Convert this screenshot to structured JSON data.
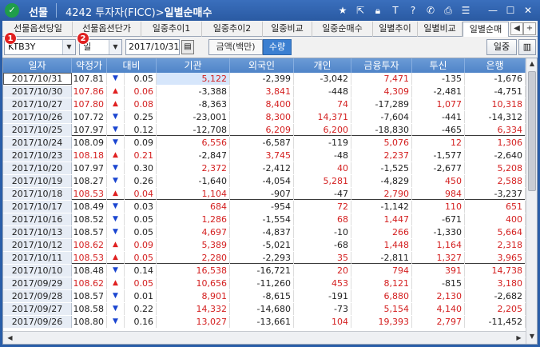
{
  "window": {
    "app_name": "선물",
    "screen_code": "4242",
    "screen_name": "투자자(FICC)",
    "sub_title": "일별순매수"
  },
  "titlebar_icons": [
    "star-icon",
    "export-icon",
    "lock-icon",
    "font-icon",
    "help-icon",
    "phone-icon",
    "print-icon",
    "menu-icon",
    "minimize-icon",
    "maximize-icon",
    "close-icon"
  ],
  "tabs": [
    {
      "label": "선물옵션당일"
    },
    {
      "label": "선물옵션단가"
    },
    {
      "label": "일중추이1"
    },
    {
      "label": "일중추이2"
    },
    {
      "label": "일중비교"
    },
    {
      "label": "일중순매수"
    },
    {
      "label": "일별추이"
    },
    {
      "label": "일별비교"
    },
    {
      "label": "일별순매"
    }
  ],
  "active_tab": 8,
  "toolbar": {
    "instrument": "KTB3Y",
    "period": "일",
    "date": "2017/10/31",
    "badge1": "1",
    "badge2": "2",
    "toggle_amount": "금액(백만)",
    "toggle_qty": "수량",
    "btn_intraday": "일중",
    "chart_icon": "bar-chart-icon"
  },
  "columns": [
    "일자",
    "약정가",
    "대비",
    "기관",
    "외국인",
    "개인",
    "금융투자",
    "투신",
    "은행"
  ],
  "rows": [
    {
      "date": "2017/10/31",
      "price": "107.81",
      "dir": "down",
      "chg": "0.05",
      "inst": "5,122",
      "foreign": "-2,399",
      "indiv": "-3,042",
      "fin": "7,471",
      "trust": "-135",
      "bank": "-1,676"
    },
    {
      "date": "2017/10/30",
      "price": "107.86",
      "dir": "up",
      "chg": "0.06",
      "inst": "-3,388",
      "foreign": "3,841",
      "indiv": "-448",
      "fin": "4,309",
      "trust": "-2,481",
      "bank": "-4,751"
    },
    {
      "date": "2017/10/27",
      "price": "107.80",
      "dir": "up",
      "chg": "0.08",
      "inst": "-8,363",
      "foreign": "8,400",
      "indiv": "74",
      "fin": "-17,289",
      "trust": "1,077",
      "bank": "10,318"
    },
    {
      "date": "2017/10/26",
      "price": "107.72",
      "dir": "down",
      "chg": "0.25",
      "inst": "-23,001",
      "foreign": "8,300",
      "indiv": "14,371",
      "fin": "-7,604",
      "trust": "-441",
      "bank": "-14,312"
    },
    {
      "date": "2017/10/25",
      "price": "107.97",
      "dir": "down",
      "chg": "0.12",
      "inst": "-12,708",
      "foreign": "6,209",
      "indiv": "6,200",
      "fin": "-18,830",
      "trust": "-465",
      "bank": "6,334"
    },
    {
      "date": "2017/10/24",
      "price": "108.09",
      "dir": "down",
      "chg": "0.09",
      "inst": "6,556",
      "foreign": "-6,587",
      "indiv": "-119",
      "fin": "5,076",
      "trust": "12",
      "bank": "1,306"
    },
    {
      "date": "2017/10/23",
      "price": "108.18",
      "dir": "up",
      "chg": "0.21",
      "inst": "-2,847",
      "foreign": "3,745",
      "indiv": "-48",
      "fin": "2,237",
      "trust": "-1,577",
      "bank": "-2,640"
    },
    {
      "date": "2017/10/20",
      "price": "107.97",
      "dir": "down",
      "chg": "0.30",
      "inst": "2,372",
      "foreign": "-2,412",
      "indiv": "40",
      "fin": "-1,525",
      "trust": "-2,677",
      "bank": "5,208"
    },
    {
      "date": "2017/10/19",
      "price": "108.27",
      "dir": "down",
      "chg": "0.26",
      "inst": "-1,640",
      "foreign": "-4,054",
      "indiv": "5,281",
      "fin": "-4,829",
      "trust": "450",
      "bank": "2,588"
    },
    {
      "date": "2017/10/18",
      "price": "108.53",
      "dir": "up",
      "chg": "0.04",
      "inst": "1,104",
      "foreign": "-907",
      "indiv": "-47",
      "fin": "2,790",
      "trust": "984",
      "bank": "-3,237"
    },
    {
      "date": "2017/10/17",
      "price": "108.49",
      "dir": "down",
      "chg": "0.03",
      "inst": "684",
      "foreign": "-954",
      "indiv": "72",
      "fin": "-1,142",
      "trust": "110",
      "bank": "651"
    },
    {
      "date": "2017/10/16",
      "price": "108.52",
      "dir": "down",
      "chg": "0.05",
      "inst": "1,286",
      "foreign": "-1,554",
      "indiv": "68",
      "fin": "1,447",
      "trust": "-671",
      "bank": "400"
    },
    {
      "date": "2017/10/13",
      "price": "108.57",
      "dir": "down",
      "chg": "0.05",
      "inst": "4,697",
      "foreign": "-4,837",
      "indiv": "-10",
      "fin": "266",
      "trust": "-1,330",
      "bank": "5,664"
    },
    {
      "date": "2017/10/12",
      "price": "108.62",
      "dir": "up",
      "chg": "0.09",
      "inst": "5,389",
      "foreign": "-5,021",
      "indiv": "-68",
      "fin": "1,448",
      "trust": "1,164",
      "bank": "2,318"
    },
    {
      "date": "2017/10/11",
      "price": "108.53",
      "dir": "up",
      "chg": "0.05",
      "inst": "2,280",
      "foreign": "-2,293",
      "indiv": "35",
      "fin": "-2,811",
      "trust": "1,327",
      "bank": "3,965"
    },
    {
      "date": "2017/10/10",
      "price": "108.48",
      "dir": "down",
      "chg": "0.14",
      "inst": "16,538",
      "foreign": "-16,721",
      "indiv": "20",
      "fin": "794",
      "trust": "391",
      "bank": "14,738"
    },
    {
      "date": "2017/09/29",
      "price": "108.62",
      "dir": "up",
      "chg": "0.05",
      "inst": "10,656",
      "foreign": "-11,260",
      "indiv": "453",
      "fin": "8,121",
      "trust": "-815",
      "bank": "3,180"
    },
    {
      "date": "2017/09/28",
      "price": "108.57",
      "dir": "down",
      "chg": "0.01",
      "inst": "8,901",
      "foreign": "-8,615",
      "indiv": "-191",
      "fin": "6,880",
      "trust": "2,130",
      "bank": "-2,682"
    },
    {
      "date": "2017/09/27",
      "price": "108.58",
      "dir": "down",
      "chg": "0.22",
      "inst": "14,332",
      "foreign": "-14,680",
      "indiv": "-73",
      "fin": "5,154",
      "trust": "4,140",
      "bank": "2,205"
    },
    {
      "date": "2017/09/26",
      "price": "108.80",
      "dir": "down",
      "chg": "0.16",
      "inst": "13,027",
      "foreign": "-13,661",
      "indiv": "104",
      "fin": "19,393",
      "trust": "2,797",
      "bank": "-11,452"
    }
  ],
  "colors": {
    "up": "#e02020",
    "down": "#1a45d0",
    "header": "#5b8fd0",
    "titlebar": "#2a5ea8"
  }
}
